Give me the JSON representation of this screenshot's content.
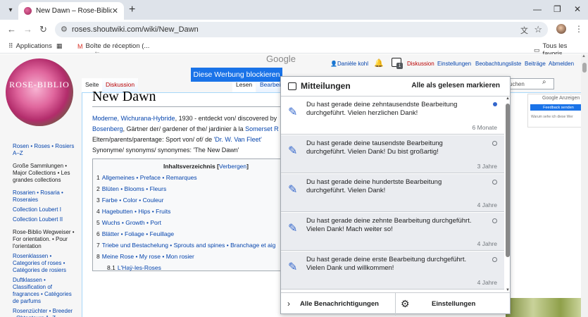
{
  "browser": {
    "tab_title": "New Dawn – Rose-Biblio",
    "url": "roses.shoutwiki.com/wiki/New_Dawn",
    "bookmarks": [
      "Applications",
      "Boîte de réception (...",
      "Tous les favoris"
    ]
  },
  "site": {
    "logo_text": "ROSE-BIBLIO",
    "personal": [
      "Danièle kohl",
      "Diskussion",
      "Einstellungen",
      "Beobachtungsliste",
      "Beiträge",
      "Abmelden"
    ],
    "tray_badge": "1",
    "tabs": [
      "Seite",
      "Diskussion",
      "Lesen",
      "Bearbei"
    ],
    "search_placeholder": "uchen",
    "sidebar": [
      {
        "text": "Rosen • Roses • Rosiers A–Z",
        "link": true
      },
      {
        "text": "Große Sammlungen • Major Collections • Les grandes collections",
        "link": false
      },
      {
        "text": "Rosarien • Rosaria • Roseraies",
        "link": true
      },
      {
        "text": "Collection Loubert I",
        "link": true
      },
      {
        "text": "Collection Loubert II",
        "link": true
      },
      {
        "text": "Rose-Biblio Wegweiser • For orientation. • Pour l'orientation",
        "link": false
      },
      {
        "text": "Rosenklassen • Categories of roses • Catégories de rosiers",
        "link": true
      },
      {
        "text": "Duftklassen • Classification of fragrances • Catégories de parfums",
        "link": true
      },
      {
        "text": "Rosenzüchter • Breeder • Obtenteurs A–Z",
        "link": true
      }
    ]
  },
  "ad": {
    "block_button": "Diese Werbung blockieren",
    "google": "Google",
    "google_ads_label": "Google Anzeigen",
    "feedback": "Feedback senden",
    "why": "Warum sehe ich diese Wer"
  },
  "article": {
    "title": "New Dawn",
    "line1_link": "Moderne, Wichurana-Hybride",
    "line1_rest": ", 1930 - entdeckt von/ discovered by",
    "line2_link1": "Bosenberg",
    "line2_rest": ", Gärtner der/ gardener of the/ jardinier à la ",
    "line2_link2": "Somerset R",
    "line3_text": "Eltern/parents/parentage: Sport von/ of/ de ",
    "line3_link": "'Dr. W. Van Fleet'",
    "line4_text": "Synonyme/ synonyms/ synonymes: 'The New Dawn'",
    "toc_title": "Inhaltsverzeichnis",
    "toc_hide": "Verbergen",
    "toc": [
      {
        "n": "1",
        "t": "Allgemeines • Preface • Remarques"
      },
      {
        "n": "2",
        "t": "Blüten • Blooms • Fleurs"
      },
      {
        "n": "3",
        "t": "Farbe • Color • Couleur"
      },
      {
        "n": "4",
        "t": "Hagebutten • Hips • Fruits"
      },
      {
        "n": "5",
        "t": "Wuchs • Growth • Port"
      },
      {
        "n": "6",
        "t": "Blätter • Foliage • Feuillage"
      },
      {
        "n": "7",
        "t": "Triebe und Bestachelung • Sprouts and spines • Branchage et aig"
      },
      {
        "n": "8",
        "t": "Meine Rose • My rose • Mon rosier"
      },
      {
        "n": "8.1",
        "t": "L'Haÿ-les-Roses"
      }
    ]
  },
  "notifications": {
    "title": "Mitteilungen",
    "mark_all": "Alle als gelesen markieren",
    "items": [
      {
        "msg": "Du hast gerade deine zehntausendste Bearbeitung durchgeführt. Vielen herzlichen Dank!",
        "ago": "6 Monate",
        "unread": true
      },
      {
        "msg": "Du hast gerade deine tausendste Bearbeitung durchgeführt. Vielen Dank! Du bist großartig!",
        "ago": "3 Jahre",
        "unread": false
      },
      {
        "msg": "Du hast gerade deine hundertste Bearbeitung durchgeführt. Vielen Dank!",
        "ago": "4 Jahre",
        "unread": false
      },
      {
        "msg": "Du hast gerade deine zehnte Bearbeitung durchgeführt. Vielen Dank! Mach weiter so!",
        "ago": "4 Jahre",
        "unread": false
      },
      {
        "msg": "Du hast gerade deine erste Bearbeitung durchgeführt. Vielen Dank und willkommen!",
        "ago": "4 Jahre",
        "unread": false
      }
    ],
    "all_label": "Alle Benachrichtigungen",
    "settings_label": "Einstellungen"
  },
  "colors": {
    "accent": "#3366cc",
    "link": "#0645ad",
    "new_link": "#ba0000",
    "ad_button": "#1a73e8"
  }
}
